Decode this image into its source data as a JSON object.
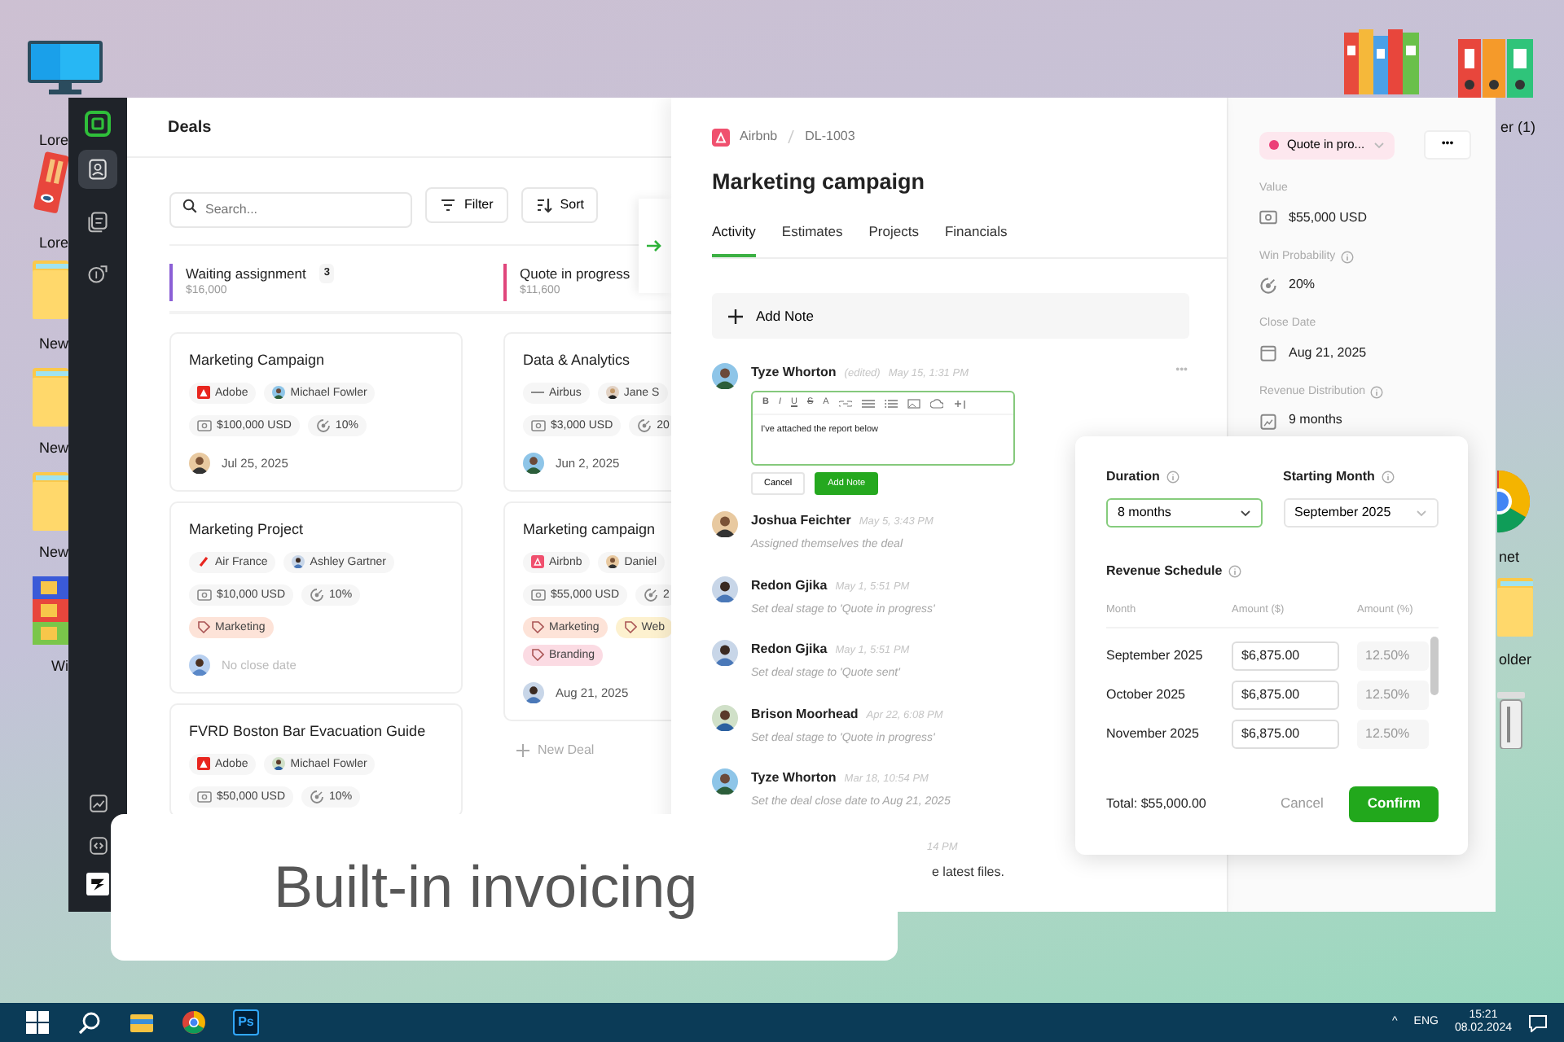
{
  "desktop": {
    "left_icons": [
      {
        "kind": "monitor",
        "label": "Lore"
      },
      {
        "kind": "binder",
        "label": "Lore"
      },
      {
        "kind": "folder",
        "label": "New"
      },
      {
        "kind": "folder",
        "label": "New"
      },
      {
        "kind": "folder",
        "label": "New"
      },
      {
        "kind": "archive",
        "label": "Wi"
      }
    ],
    "right_icons": [
      {
        "kind": "books"
      },
      {
        "kind": "binders",
        "label": "er (1)"
      },
      {
        "kind": "browser",
        "label": "net"
      },
      {
        "kind": "folder",
        "label": "older"
      },
      {
        "kind": "bin"
      }
    ]
  },
  "sidebar": {
    "items": [
      {
        "kind": "contacts",
        "selected": true
      },
      {
        "kind": "notes",
        "selected": false
      },
      {
        "kind": "deals",
        "selected": false
      }
    ],
    "bottom_items": [
      {
        "kind": "chart"
      },
      {
        "kind": "code"
      }
    ]
  },
  "board": {
    "title": "Deals",
    "search": {
      "placeholder": "Search..."
    },
    "buttons": [
      {
        "kind": "filter",
        "label": "Filter"
      },
      {
        "kind": "sort",
        "label": "Sort"
      }
    ],
    "columns": [
      {
        "title": "Waiting assignment",
        "count": "3",
        "total": "$16,000",
        "color": "#8b5fd6",
        "cards": [
          {
            "title": "Marketing Campaign",
            "company": {
              "kind": "adobe",
              "name": "Adobe"
            },
            "owner": "Michael Fowler",
            "value": "$100,000 USD",
            "probability": "10%",
            "date": "Jul 25, 2025",
            "date_set": true
          },
          {
            "title": "Marketing Project",
            "company": {
              "kind": "airfrance",
              "name": "Air France"
            },
            "owner": "Ashley Gartner",
            "value": "$10,000 USD",
            "probability": "10%",
            "tags": [
              {
                "label": "Marketing",
                "color": "#fde3d8"
              }
            ],
            "date": "No close date",
            "date_set": false
          },
          {
            "title": "FVRD Boston Bar Evacuation Guide",
            "company": {
              "kind": "adobe",
              "name": "Adobe"
            },
            "owner": "Michael Fowler",
            "value": "$50,000 USD",
            "probability": "10%"
          }
        ]
      },
      {
        "title": "Quote in progress",
        "total": "$11,600",
        "color": "#e0457b",
        "cards": [
          {
            "title": "Data & Analytics",
            "company": {
              "kind": "airbus",
              "name": "Airbus"
            },
            "owner": "Jane S",
            "value": "$3,000 USD",
            "probability": "20",
            "date": "Jun 2, 2025",
            "date_set": true
          },
          {
            "title": "Marketing campaign",
            "company": {
              "kind": "airbnb",
              "name": "Airbnb"
            },
            "owner": "Daniel",
            "value": "$55,000 USD",
            "probability": "2",
            "tags": [
              {
                "label": "Marketing",
                "color": "#fde3d8"
              },
              {
                "label": "Web",
                "color": "#fdf1cf"
              },
              {
                "label": "Branding",
                "color": "#fbdbe3"
              }
            ],
            "date": "Aug 21, 2025",
            "date_set": true
          }
        ],
        "add_label": "New Deal"
      }
    ]
  },
  "detail": {
    "company": "Airbnb",
    "deal_id": "DL-1003",
    "title": "Marketing campaign",
    "tabs": [
      {
        "label": "Activity",
        "selected": true
      },
      {
        "label": "Estimates",
        "selected": false
      },
      {
        "label": "Projects",
        "selected": false
      },
      {
        "label": "Financials",
        "selected": false
      }
    ],
    "add_note": "Add Note",
    "activity": [
      {
        "kind": "editor",
        "name": "Tyze Whorton",
        "note": "(edited)",
        "time": "May 15, 1:31 PM",
        "toolbar": [
          "B",
          "I",
          "U",
          "S",
          "A"
        ],
        "text": "I've attached the report below",
        "buttons": [
          "Cancel",
          "Add Note"
        ],
        "menu": "•••"
      },
      {
        "kind": "event",
        "name": "Joshua Feichter",
        "time": "May 5, 3:43 PM",
        "text": "Assigned themselves the deal"
      },
      {
        "kind": "event",
        "name": "Redon Gjika",
        "time": "May 1, 5:51 PM",
        "text": "Set deal stage to 'Quote in progress'"
      },
      {
        "kind": "event",
        "name": "Redon Gjika",
        "time": "May 1, 5:51 PM",
        "text": "Set deal stage to 'Quote sent'"
      },
      {
        "kind": "event",
        "name": "Brison Moorhead",
        "time": "Apr 22, 6:08 PM",
        "text": "Set deal stage to 'Quote in progress'"
      },
      {
        "kind": "event",
        "name": "Tyze Whorton",
        "time": "Mar 18, 10:54 PM",
        "text": "Set the deal close date to Aug 21, 2025"
      },
      {
        "kind": "partial",
        "time": "14 PM",
        "text": "e latest files."
      }
    ]
  },
  "properties": {
    "status": {
      "label": "Quote in pro...",
      "color": "#ec3f78"
    },
    "more": "•••",
    "fields": [
      {
        "kind": "money",
        "label": "Value",
        "value": "$55,000 USD",
        "info": false
      },
      {
        "kind": "gauge",
        "label": "Win Probability",
        "value": "20%",
        "info": true
      },
      {
        "kind": "calendar",
        "label": "Close Date",
        "value": "Aug 21, 2025",
        "info": false
      },
      {
        "kind": "schedule",
        "label": "Revenue Distribution",
        "value": "9 months",
        "info": true
      }
    ]
  },
  "popup": {
    "selects": [
      {
        "label": "Duration",
        "value": "8 months",
        "focused": true
      },
      {
        "label": "Starting Month",
        "value": "September 2025",
        "focused": false
      }
    ],
    "schedule_title": "Revenue Schedule",
    "columns": [
      "Month",
      "Amount ($)",
      "Amount (%)"
    ],
    "rows": [
      {
        "month": "September 2025",
        "amount": "$6,875.00",
        "percent": "12.50%"
      },
      {
        "month": "October 2025",
        "amount": "$6,875.00",
        "percent": "12.50%"
      },
      {
        "month": "November 2025",
        "amount": "$6,875.00",
        "percent": "12.50%"
      }
    ],
    "total": "Total: $55,000.00",
    "buttons": [
      "Cancel",
      "Confirm"
    ]
  },
  "caption": "Built-in invoicing",
  "taskbar": {
    "apps": [
      {
        "kind": "start"
      },
      {
        "kind": "search"
      },
      {
        "kind": "explorer"
      },
      {
        "kind": "browser"
      },
      {
        "kind": "photo",
        "label": "Ps"
      }
    ],
    "tray_arrow": "^",
    "language": "ENG",
    "time": "15:21",
    "date": "08.02.2024"
  }
}
